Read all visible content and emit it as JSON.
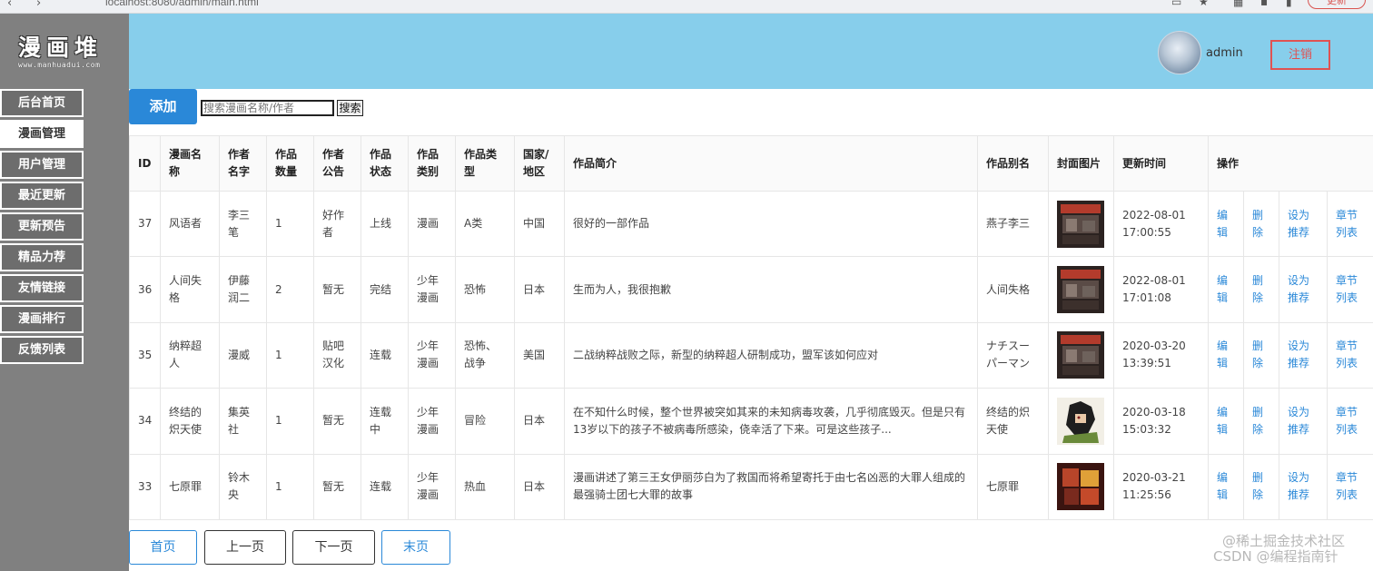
{
  "browser": {
    "url": "localhost:8080/admin/main.html",
    "update_label": "更新"
  },
  "logo": {
    "main": "漫画堆",
    "sub": "www.manhuadui.com"
  },
  "sidebar": {
    "items": [
      {
        "label": "后台首页"
      },
      {
        "label": "漫画管理"
      },
      {
        "label": "用户管理"
      },
      {
        "label": "最近更新"
      },
      {
        "label": "更新预告"
      },
      {
        "label": "精品力荐"
      },
      {
        "label": "友情链接"
      },
      {
        "label": "漫画排行"
      },
      {
        "label": "反馈列表"
      }
    ],
    "active_index": 1
  },
  "header": {
    "username": "admin",
    "logout_label": "注销"
  },
  "toolbar": {
    "add_label": "添加",
    "search_placeholder": "搜索漫画名称/作者",
    "search_label": "搜索"
  },
  "table": {
    "headers": [
      "ID",
      "漫画名称",
      "作者名字",
      "作品数量",
      "作者公告",
      "作品状态",
      "作品类别",
      "作品类型",
      "国家/地区",
      "作品简介",
      "作品别名",
      "封面图片",
      "更新时间",
      "操作"
    ],
    "rows": [
      {
        "id": "37",
        "name": "风语者",
        "author": "李三笔",
        "count": "1",
        "notice": "好作者",
        "status": "上线",
        "category": "漫画",
        "type": "A类",
        "country": "中国",
        "intro": "很好的一部作品",
        "alias": "燕子李三",
        "time": "2022-08-01 17:00:55",
        "cover": "cover-dark"
      },
      {
        "id": "36",
        "name": "人间失格",
        "author": "伊藤润二",
        "count": "2",
        "notice": "暂无",
        "status": "完结",
        "category": "少年漫画",
        "type": "恐怖",
        "country": "日本",
        "intro": "生而为人，我很抱歉",
        "alias": "人间失格",
        "time": "2022-08-01 17:01:08",
        "cover": "cover-dark"
      },
      {
        "id": "35",
        "name": "纳粹超人",
        "author": "漫威",
        "count": "1",
        "notice": "贴吧汉化",
        "status": "连载",
        "category": "少年漫画",
        "type": "恐怖、战争",
        "country": "美国",
        "intro": "二战纳粹战败之际，新型的纳粹超人研制成功，盟军该如何应对",
        "alias": "ナチスーパーマン",
        "time": "2020-03-20 13:39:51",
        "cover": "cover-dark"
      },
      {
        "id": "34",
        "name": "终结的炽天使",
        "author": "集英社",
        "count": "1",
        "notice": "暂无",
        "status": "连载中",
        "category": "少年漫画",
        "type": "冒险",
        "country": "日本",
        "intro": "在不知什么时候，整个世界被突如其来的未知病毒攻袭，几乎彻底毁灭。但是只有13岁以下的孩子不被病毒所感染，侥幸活了下来。可是这些孩子...",
        "alias": "终结的炽天使",
        "time": "2020-03-18 15:03:32",
        "cover": "cover-anime"
      },
      {
        "id": "33",
        "name": "七原罪",
        "author": "铃木央",
        "count": "1",
        "notice": "暂无",
        "status": "连载",
        "category": "少年漫画",
        "type": "热血",
        "country": "日本",
        "intro": "漫画讲述了第三王女伊丽莎白为了救国而将希望寄托于由七名凶恶的大罪人组成的最强骑士团七大罪的故事",
        "alias": "七原罪",
        "time": "2020-03-21 11:25:56",
        "cover": "cover-red"
      }
    ],
    "actions": {
      "edit": "编辑",
      "delete": "删除",
      "recommend": "设为推荐",
      "chapters": "章节列表"
    }
  },
  "pagination": {
    "first": "首页",
    "prev": "上一页",
    "next": "下一页",
    "last": "末页"
  },
  "watermark": {
    "line1": "@稀土掘金技术社区",
    "line2": "CSDN @编程指南针"
  },
  "colors": {
    "sidebar": "#808080",
    "header": "#87ceeb",
    "accent": "#2a88d8",
    "logout": "#e05252"
  }
}
